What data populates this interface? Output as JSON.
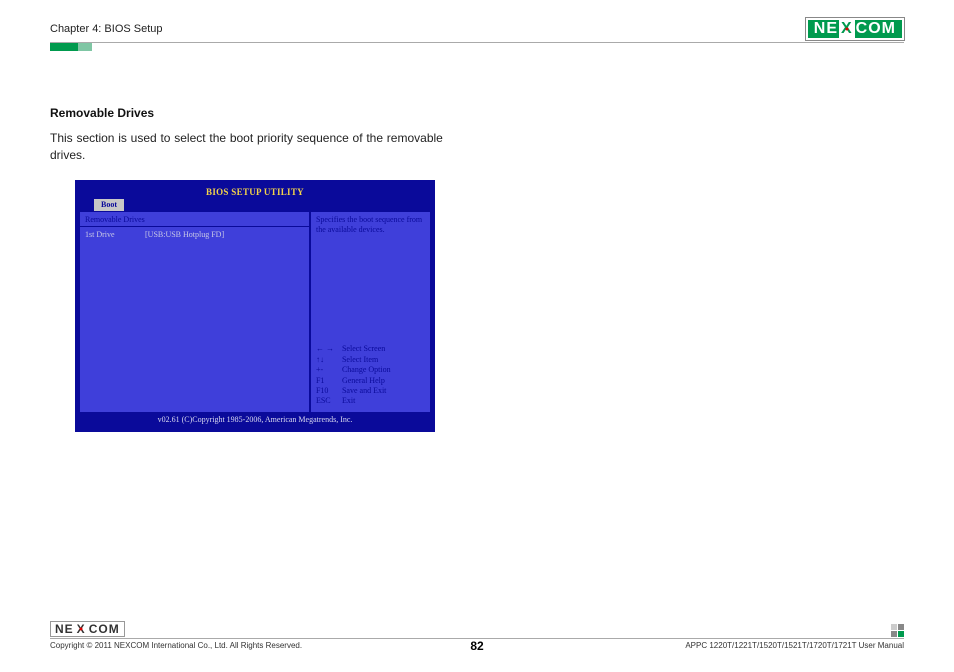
{
  "header": {
    "chapter": "Chapter 4: BIOS Setup",
    "logo_left": "NE",
    "logo_x": "X",
    "logo_right": "COM"
  },
  "section": {
    "title": "Removable Drives",
    "description": "This section is used to select the boot priority sequence of the removable drives."
  },
  "bios": {
    "title": "BIOS SETUP UTILITY",
    "tab": "Boot",
    "left_header": "Removable Drives",
    "item_label": "1st Drive",
    "item_value": "[USB:USB Hotplug FD]",
    "help_text": "Specifies the boot sequence from the available devices.",
    "keys": [
      {
        "key": "← →",
        "action": "Select Screen"
      },
      {
        "key": "↑↓",
        "action": "Select Item"
      },
      {
        "key": "+-",
        "action": "Change Option"
      },
      {
        "key": "F1",
        "action": "General Help"
      },
      {
        "key": "F10",
        "action": "Save and Exit"
      },
      {
        "key": "ESC",
        "action": "Exit"
      }
    ],
    "footer": "v02.61 (C)Copyright 1985-2006, American Megatrends, Inc."
  },
  "footer": {
    "copyright": "Copyright © 2011 NEXCOM International Co., Ltd. All Rights Reserved.",
    "page_number": "82",
    "manual": "APPC 1220T/1221T/1520T/1521T/1720T/1721T User Manual"
  }
}
